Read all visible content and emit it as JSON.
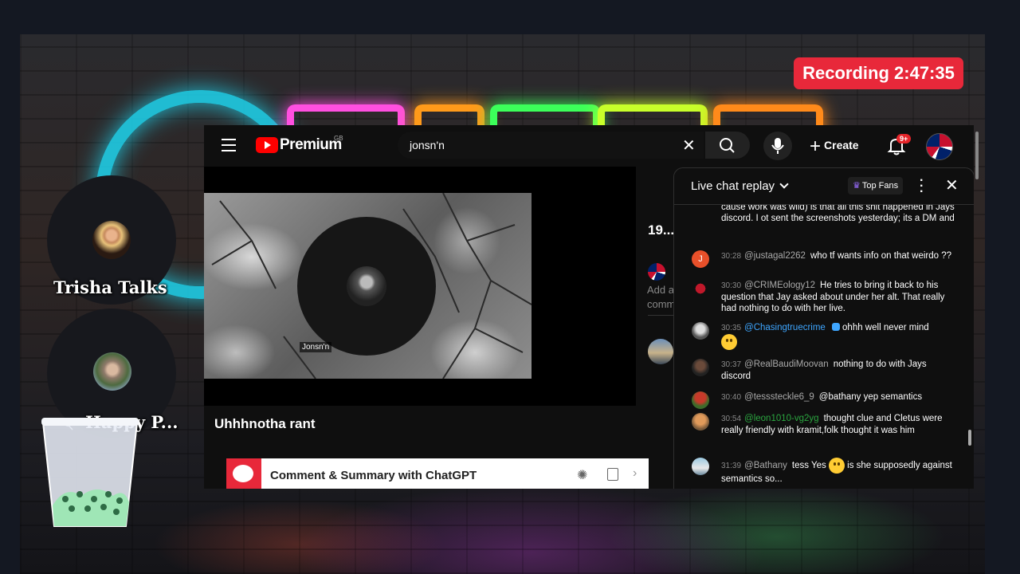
{
  "overlay": {
    "recording_label": "Recording 2:47:35"
  },
  "guests": [
    {
      "name": "Trisha Talks"
    },
    {
      "name": "Happy P..."
    }
  ],
  "youtube": {
    "brand": "Premium",
    "region": "GB",
    "search_value": "jonsn'n",
    "create_label": "Create",
    "notifications_badge": "9+",
    "video": {
      "channel_label": "Jonsn'n",
      "title": "Uhhhnotha rant"
    },
    "extension": {
      "label": "Comment & Summary with ChatGPT"
    },
    "sidebar": {
      "count_text": "19...",
      "add_text": "Add a",
      "comm_text": "comm"
    },
    "chat": {
      "title": "Live chat replay",
      "top_fans_label": "Top Fans",
      "messages": [
        {
          "time": "",
          "author": "",
          "text": "cause work was wild) is that all this shit happened in Jays discord. I ot sent the screenshots yesterday; its a DM and"
        },
        {
          "time": "30:28",
          "author": "@justagal2262",
          "text": "who tf wants info on that weirdo ??"
        },
        {
          "time": "30:30",
          "author": "@CRIMEology12",
          "text": "He tries to bring it back to his question that Jay asked about under her alt. That really had nothing to do with her live."
        },
        {
          "time": "30:35",
          "author": "@Chasingtruecrime",
          "text": "ohhh well never mind"
        },
        {
          "time": "30:37",
          "author": "@RealBaudiMoovan",
          "text": "nothing to do with Jays discord"
        },
        {
          "time": "30:40",
          "author": "@tesssteckle6_9",
          "text": "@bathany yep semantics"
        },
        {
          "time": "30:54",
          "author": "@leon1010-vg2yg",
          "text": "thought clue and Cletus were really friendly with kramit,folk thought it was him"
        },
        {
          "time": "31:39",
          "author": "@Bathany",
          "text": "tess Yes",
          "text2": "is she supposedly against semantics so..."
        }
      ]
    }
  },
  "colors": {
    "recording_red": "#e8283a",
    "youtube_red": "#ff0000",
    "link_blue": "#3ea6ff",
    "member_green": "#2ba640"
  },
  "icons": {
    "menu": "hamburger-icon",
    "search": "search-icon",
    "clear": "close-icon",
    "voice": "microphone-icon",
    "create": "plus-icon",
    "notifications": "bell-icon",
    "chatgpt": "openai-icon",
    "copy": "copy-icon"
  }
}
